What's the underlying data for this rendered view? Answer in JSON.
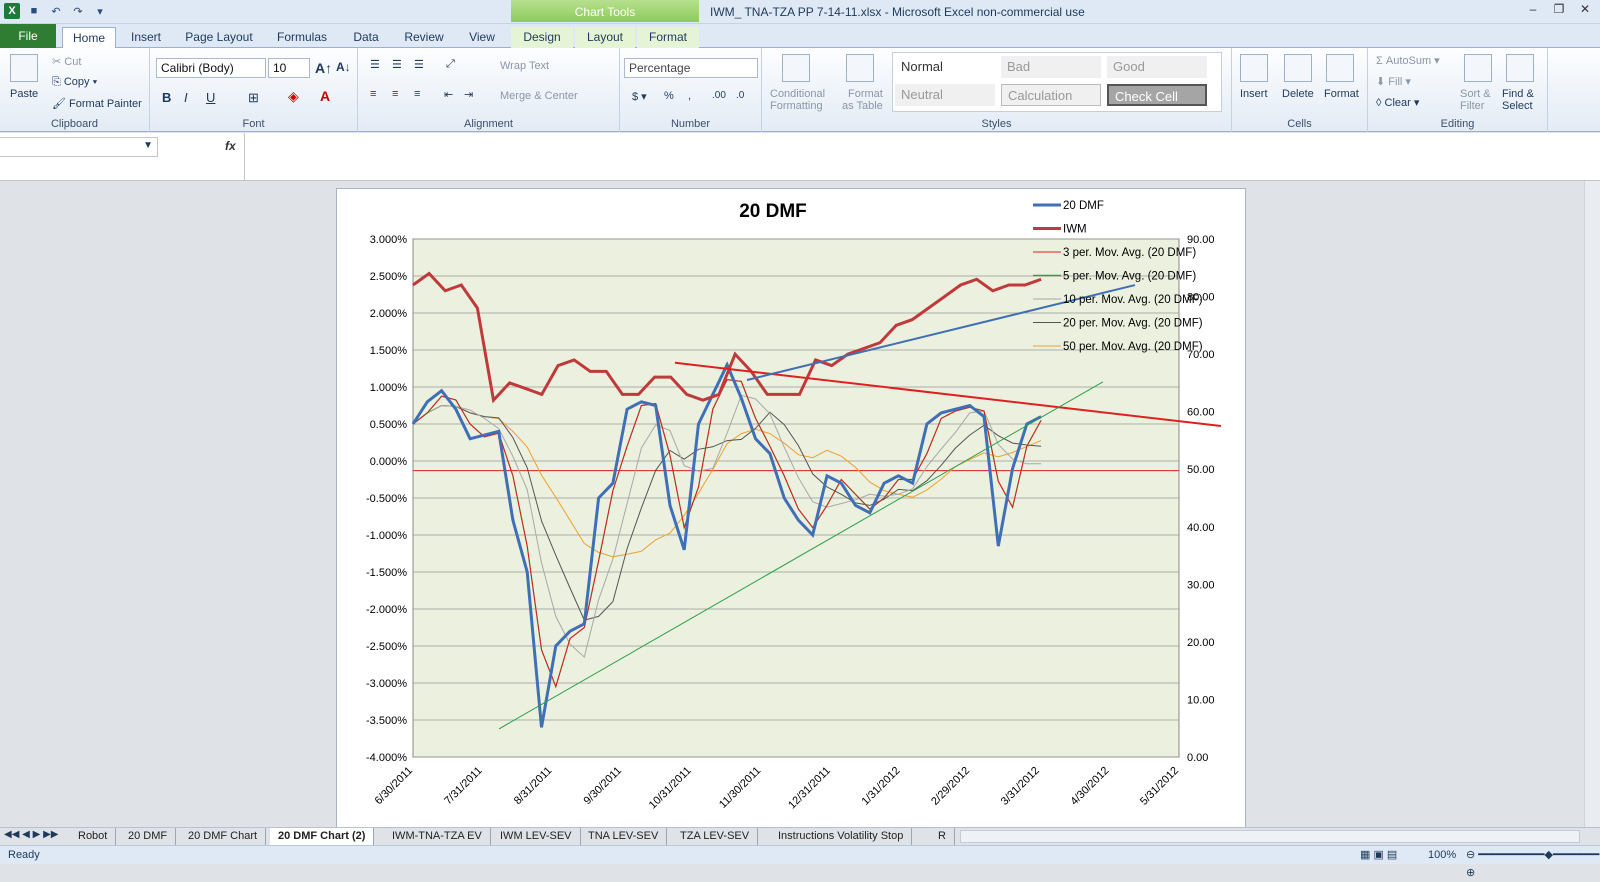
{
  "title_bar": {
    "doc_title": "IWM_ TNA-TZA PP 7-14-11.xlsx  -  Microsoft Excel non-commercial use",
    "chart_tools": "Chart Tools"
  },
  "tabs": [
    "File",
    "Home",
    "Insert",
    "Page Layout",
    "Formulas",
    "Data",
    "Review",
    "View",
    "Design",
    "Layout",
    "Format"
  ],
  "ribbon": {
    "clipboard": {
      "paste": "Paste",
      "cut": "Cut",
      "copy": "Copy",
      "format_painter": "Format Painter",
      "label": "Clipboard"
    },
    "font": {
      "name": "Calibri (Body)",
      "size": "10",
      "label": "Font"
    },
    "alignment": {
      "wrap": "Wrap Text",
      "merge": "Merge & Center",
      "label": "Alignment"
    },
    "number": {
      "format": "Percentage",
      "label": "Number"
    },
    "styles": {
      "conditional": "Conditional",
      "formatting": "Formatting",
      "format_as": "Format",
      "as_table": "as Table",
      "normal": "Normal",
      "bad": "Bad",
      "good": "Good",
      "neutral": "Neutral",
      "calculation": "Calculation",
      "check_cell": "Check Cell",
      "label": "Styles"
    },
    "cells": {
      "insert": "Insert",
      "delete": "Delete",
      "format": "Format",
      "label": "Cells"
    },
    "editing": {
      "autosum": "AutoSum",
      "fill": "Fill",
      "clear": "Clear",
      "sort": "Sort &",
      "filter": "Filter",
      "find": "Find &",
      "select": "Select",
      "label": "Editing"
    }
  },
  "sheet_tabs": [
    "Robot",
    "20 DMF",
    "20 DMF Chart",
    "20 DMF Chart (2)",
    "IWM-TNA-TZA EV",
    "IWM LEV-SEV",
    "TNA LEV-SEV",
    "TZA LEV-SEV",
    "Instructions Volatility Stop",
    "R"
  ],
  "active_sheet": "20 DMF Chart (2)",
  "status": {
    "ready": "Ready",
    "zoom": "100%"
  },
  "chart_data": {
    "type": "line",
    "title": "20 DMF",
    "y_left": {
      "ticks": [
        "3.000%",
        "2.500%",
        "2.000%",
        "1.500%",
        "1.000%",
        "0.500%",
        "0.000%",
        "-0.500%",
        "-1.000%",
        "-1.500%",
        "-2.000%",
        "-2.500%",
        "-3.000%",
        "-3.500%",
        "-4.000%"
      ],
      "range": [
        -0.04,
        0.03
      ]
    },
    "y_right": {
      "ticks": [
        "90.00",
        "80.00",
        "70.00",
        "60.00",
        "50.00",
        "40.00",
        "30.00",
        "20.00",
        "10.00",
        "0.00"
      ],
      "range": [
        0,
        90
      ]
    },
    "x_ticks": [
      "6/30/2011",
      "7/31/2011",
      "8/31/2011",
      "9/30/2011",
      "10/31/2011",
      "11/30/2011",
      "12/31/2011",
      "1/31/2012",
      "2/29/2012",
      "3/31/2012",
      "4/30/2012",
      "5/31/2012"
    ],
    "legend": [
      "20 DMF",
      "IWM",
      "3 per. Mov. Avg. (20 DMF)",
      "5 per. Mov. Avg. (20 DMF)",
      "10 per. Mov. Avg. (20 DMF)",
      "20 per. Mov. Avg. (20 DMF)",
      "50 per. Mov. Avg. (20 DMF)"
    ],
    "colors": {
      "dmf": "#3f6fb6",
      "iwm": "#c0393b",
      "ma3": "#e02020",
      "ma5": "#2e9e4a",
      "ma10": "#a8a8a8",
      "ma20": "#555555",
      "ma50": "#f0a030",
      "plot_bg": "#ebf1de"
    },
    "series_dmf": [
      0.5,
      0.8,
      0.95,
      0.7,
      0.3,
      0.35,
      0.4,
      -0.8,
      -1.5,
      -3.6,
      -2.5,
      -2.3,
      -2.2,
      -0.5,
      -0.3,
      0.7,
      0.8,
      0.75,
      -0.6,
      -1.2,
      0.5,
      0.9,
      1.3,
      0.85,
      0.3,
      0.1,
      -0.5,
      -0.8,
      -1.0,
      -0.2,
      -0.3,
      -0.6,
      -0.7,
      -0.3,
      -0.2,
      -0.3,
      0.5,
      0.65,
      0.7,
      0.75,
      0.6,
      -1.15,
      -0.1,
      0.5,
      0.6
    ],
    "series_iwm": [
      82,
      84,
      81,
      82,
      78,
      62,
      65,
      64,
      63,
      68,
      69,
      67,
      67,
      63,
      63,
      66,
      66,
      63,
      62,
      63,
      70,
      67,
      63,
      63,
      63,
      69,
      68,
      70,
      71,
      72,
      75,
      76,
      78,
      80,
      82,
      83,
      81,
      82,
      82,
      83
    ]
  }
}
